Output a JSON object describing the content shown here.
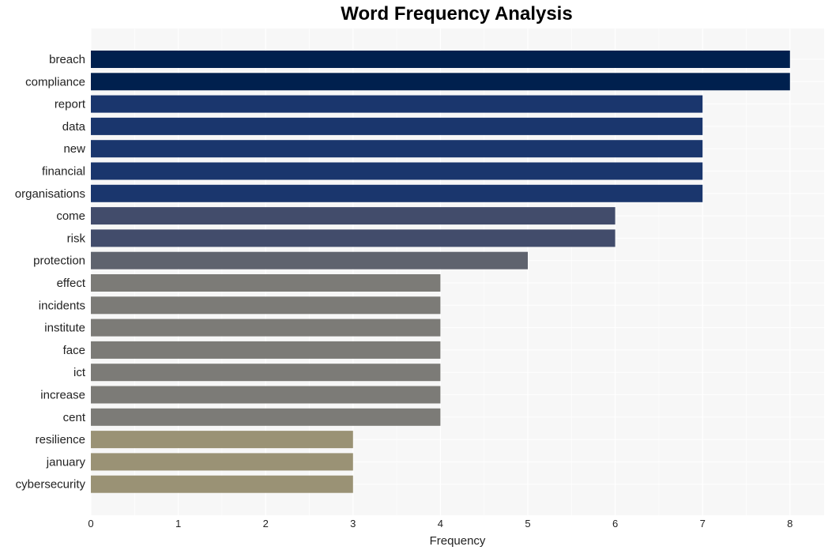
{
  "chart_data": {
    "type": "bar",
    "orientation": "horizontal",
    "title": "Word Frequency Analysis",
    "xlabel": "Frequency",
    "ylabel": "",
    "xlim": [
      0,
      8.4
    ],
    "xticks": [
      0,
      1,
      2,
      3,
      4,
      5,
      6,
      7,
      8
    ],
    "grid": true,
    "legend": "none",
    "categories": [
      "breach",
      "compliance",
      "report",
      "data",
      "new",
      "financial",
      "organisations",
      "come",
      "risk",
      "protection",
      "effect",
      "incidents",
      "institute",
      "face",
      "ict",
      "increase",
      "cent",
      "resilience",
      "january",
      "cybersecurity"
    ],
    "values": [
      8,
      8,
      7,
      7,
      7,
      7,
      7,
      6,
      6,
      5,
      4,
      4,
      4,
      4,
      4,
      4,
      4,
      3,
      3,
      3
    ],
    "colors_by_value": {
      "8": "#00204e",
      "7": "#1a366d",
      "6": "#424c6b",
      "5": "#5f636e",
      "4": "#7c7b77",
      "3": "#9a9275"
    },
    "background": "#f7f7f7"
  }
}
